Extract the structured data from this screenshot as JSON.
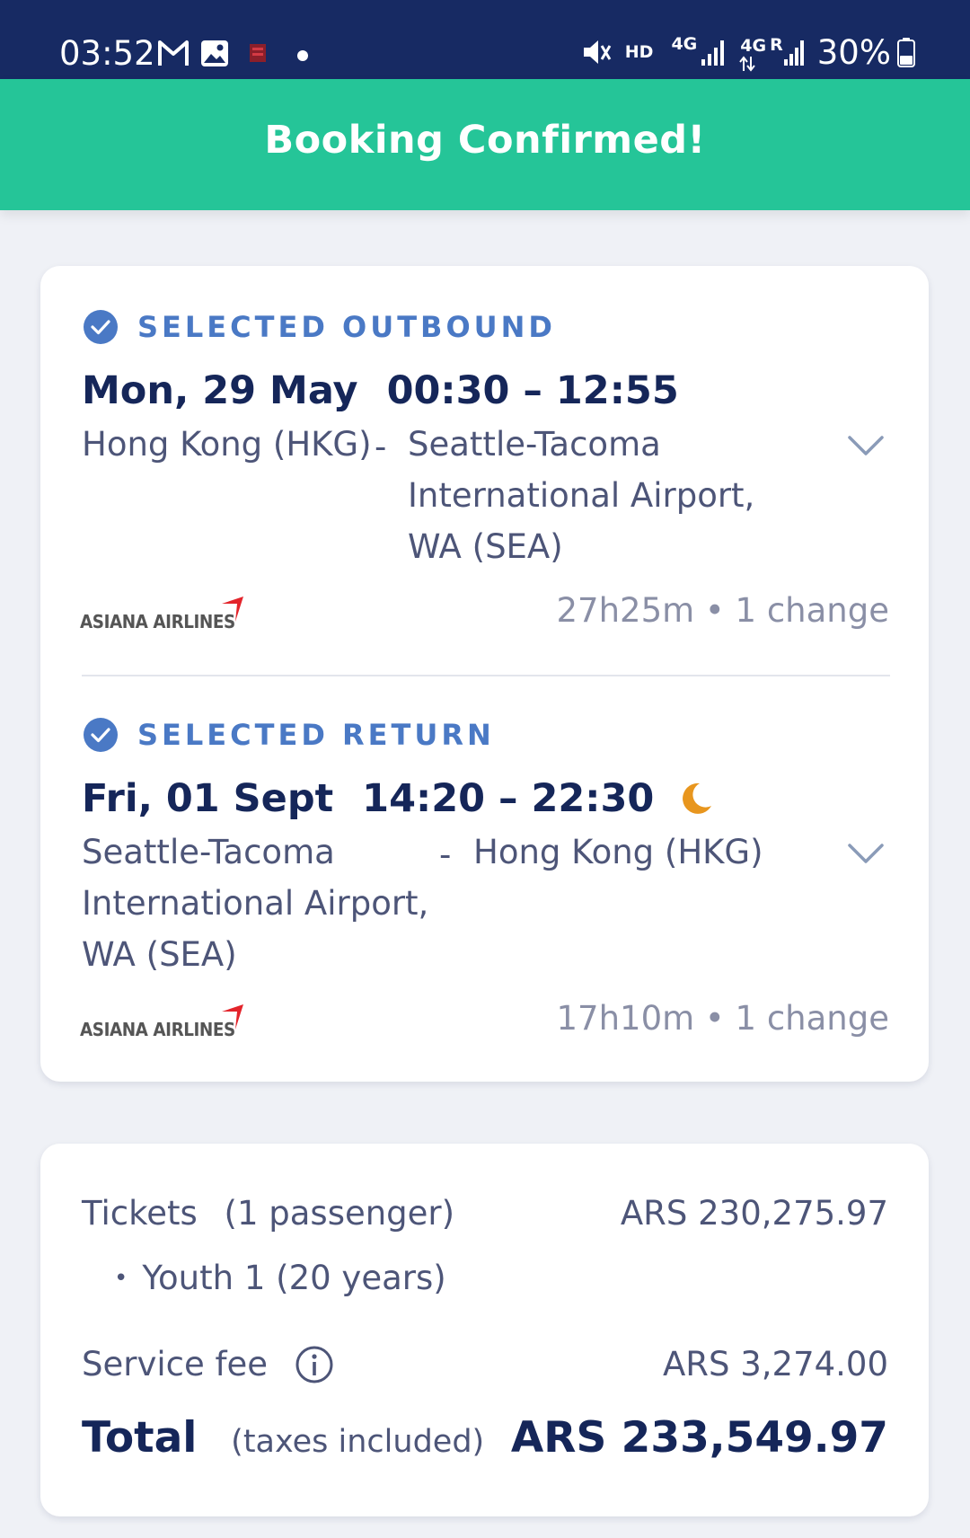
{
  "status_bar": {
    "time": "03:52",
    "hd": "HD",
    "net1": "4G",
    "net2": "4G",
    "roaming": "R",
    "battery": "30%",
    "left_icons": [
      "gmail-icon",
      "gallery-icon",
      "app-icon",
      "dot-icon"
    ],
    "right_icons": [
      "mute-icon",
      "signal-icon",
      "signal-icon",
      "battery-icon"
    ]
  },
  "header": {
    "title": "Booking Confirmed!"
  },
  "outbound": {
    "label": "SELECTED OUTBOUND",
    "date": "Mon, 29 May",
    "times": "00:30 – 12:55",
    "from": "Hong Kong (HKG)",
    "separator": "-",
    "to": [
      "Seattle-Tacoma",
      "International Airport,",
      "WA (SEA)"
    ],
    "airline": "ASIANA AIRLINES",
    "duration": "27h25m • 1 change"
  },
  "return": {
    "label": "SELECTED RETURN",
    "date": "Fri, 01 Sept",
    "times": "14:20 – 22:30",
    "from": [
      "Seattle-Tacoma",
      "International Airport,",
      "WA (SEA)"
    ],
    "separator": "-",
    "to": "Hong Kong (HKG)",
    "airline": "ASIANA AIRLINES",
    "duration": "17h10m • 1 change"
  },
  "price": {
    "tickets_label": "Tickets",
    "tickets_sub": "(1 passenger)",
    "tickets_value": "ARS 230,275.97",
    "youth": "Youth 1 (20 years)",
    "service_label": "Service fee",
    "service_value": "ARS 3,274.00",
    "total_label": "Total",
    "total_sub": "(taxes included)",
    "total_value": "ARS 233,549.97"
  },
  "colors": {
    "status_bar": "#172a63",
    "header": "#25c598",
    "accent_blue": "#4a79c5",
    "navy_text": "#152659",
    "airline_red": "#e3242b",
    "moon": "#e8961e"
  }
}
